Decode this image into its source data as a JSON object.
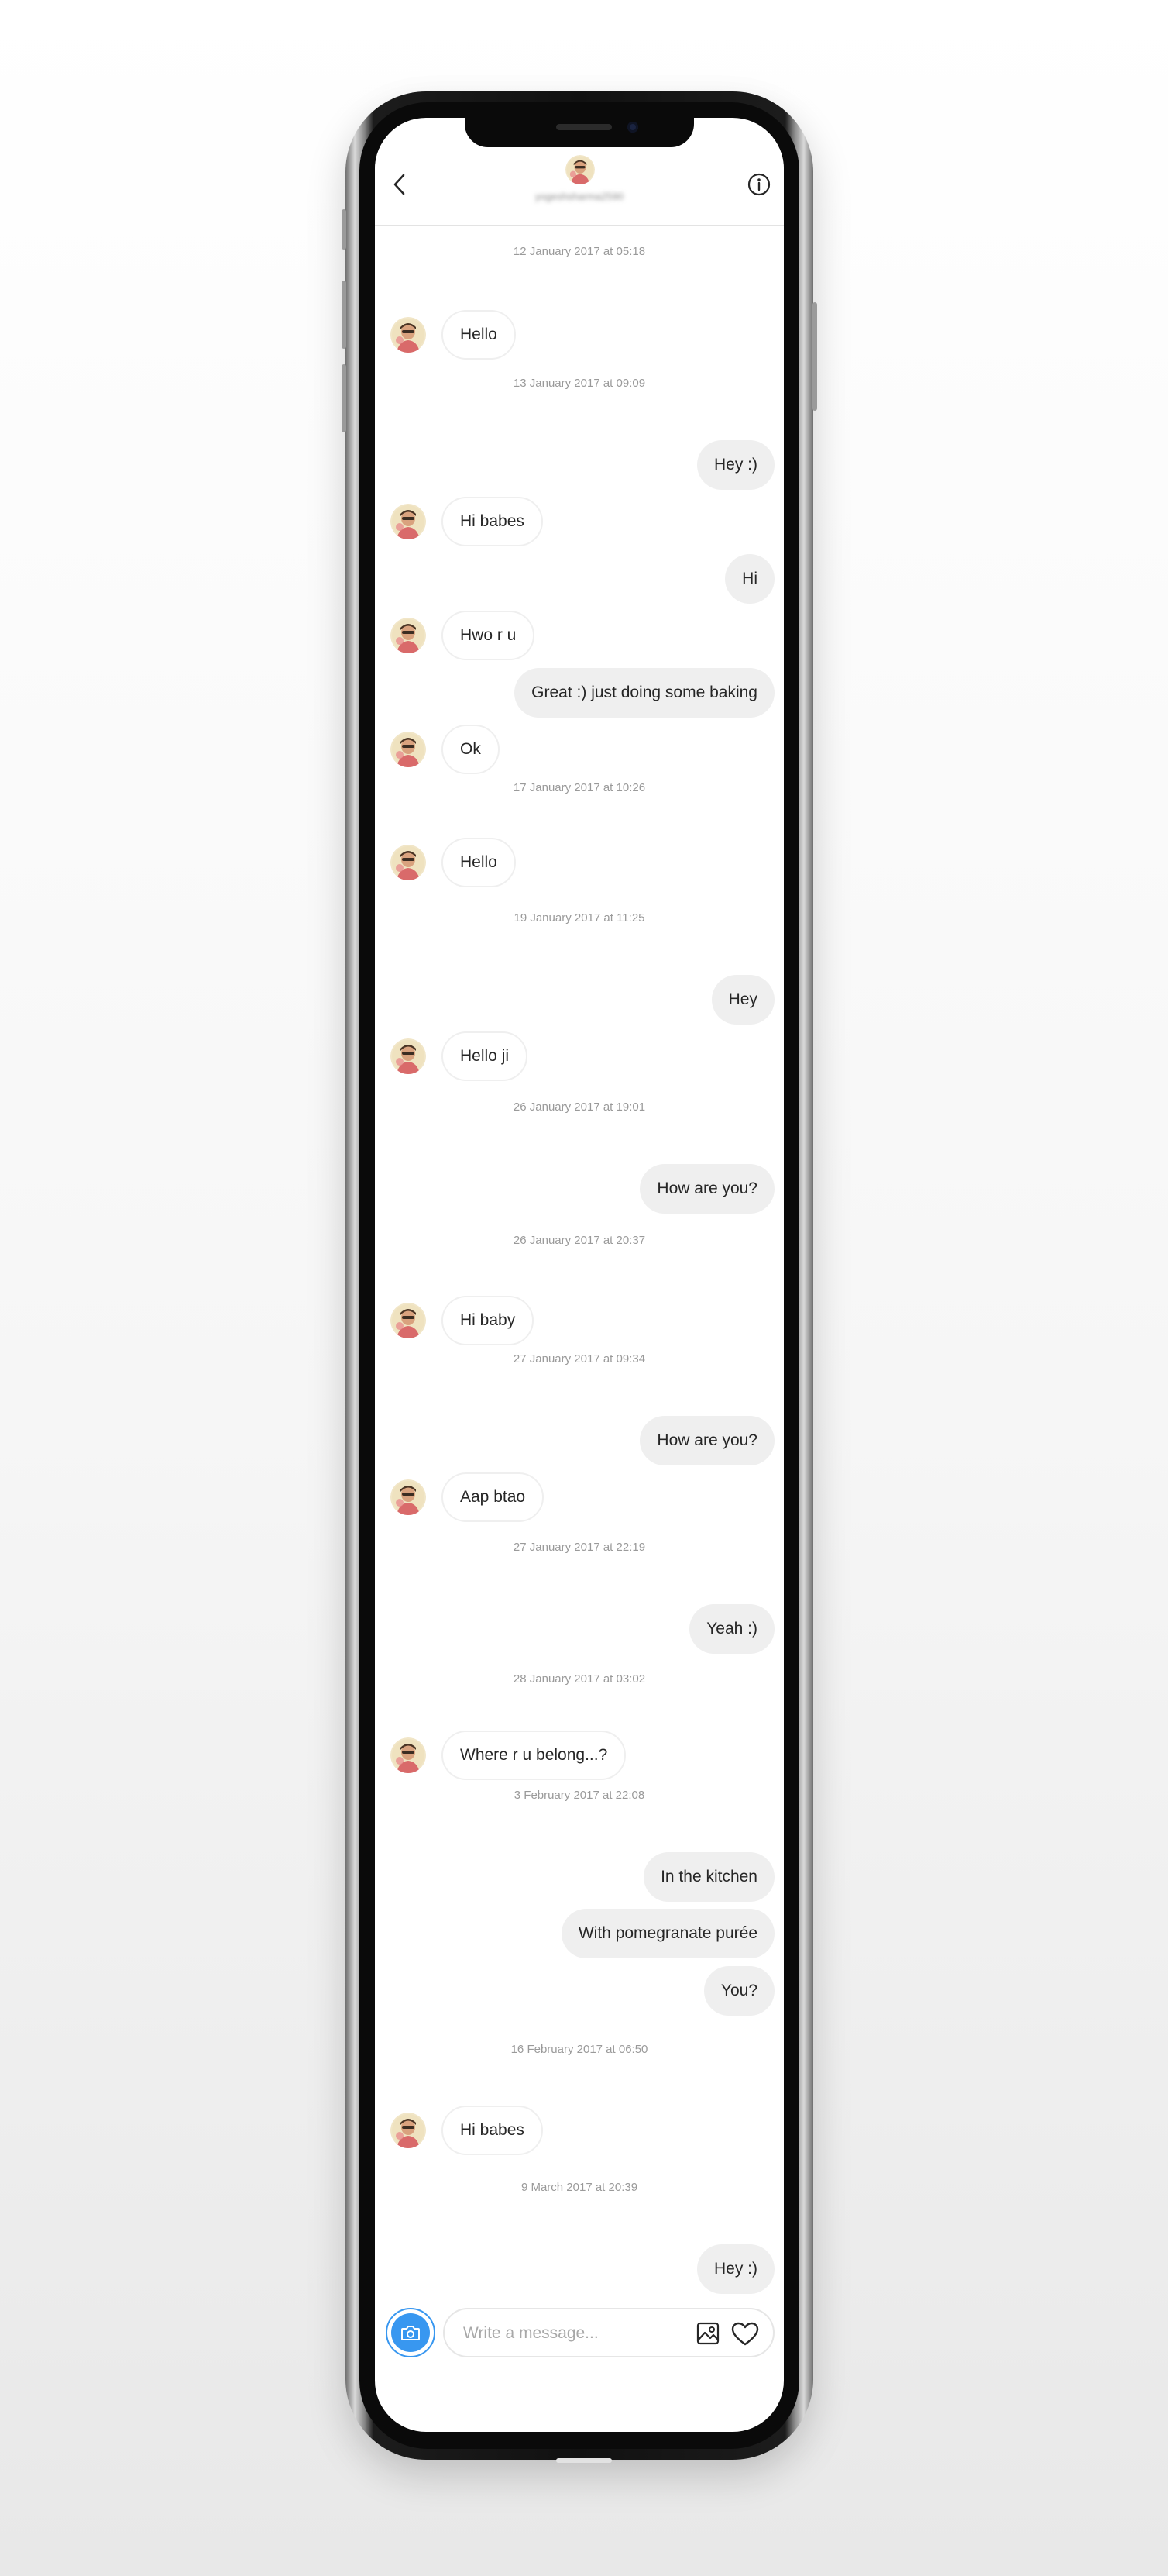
{
  "header": {
    "username": "yogeshsharma2590",
    "back_icon": "chevron-left-icon",
    "info_icon": "info-circle-icon"
  },
  "thread": [
    {
      "type": "timestamp",
      "text": "12 January 2017 at 05:18"
    },
    {
      "type": "in",
      "text": "Hello"
    },
    {
      "type": "timestamp",
      "text": "13 January 2017 at 09:09"
    },
    {
      "type": "out",
      "text": "Hey :)"
    },
    {
      "type": "in",
      "text": "Hi babes"
    },
    {
      "type": "out",
      "text": "Hi"
    },
    {
      "type": "in",
      "text": "Hwo r u"
    },
    {
      "type": "out",
      "text": "Great :) just doing some baking"
    },
    {
      "type": "in",
      "text": "Ok"
    },
    {
      "type": "timestamp",
      "text": "17 January 2017 at 10:26"
    },
    {
      "type": "in",
      "text": "Hello"
    },
    {
      "type": "timestamp",
      "text": "19 January 2017 at 11:25"
    },
    {
      "type": "out",
      "text": "Hey"
    },
    {
      "type": "in",
      "text": "Hello ji"
    },
    {
      "type": "timestamp",
      "text": "26 January 2017 at 19:01"
    },
    {
      "type": "out",
      "text": "How are you?"
    },
    {
      "type": "timestamp",
      "text": "26 January 2017 at 20:37"
    },
    {
      "type": "in",
      "text": "Hi baby"
    },
    {
      "type": "timestamp",
      "text": "27 January 2017 at 09:34"
    },
    {
      "type": "out",
      "text": "How are you?"
    },
    {
      "type": "in",
      "text": "Aap btao"
    },
    {
      "type": "timestamp",
      "text": "27 January 2017 at 22:19"
    },
    {
      "type": "out",
      "text": "Yeah :)"
    },
    {
      "type": "timestamp",
      "text": "28 January 2017 at 03:02"
    },
    {
      "type": "in",
      "text": "Where r u belong...?"
    },
    {
      "type": "timestamp",
      "text": "3 February 2017 at 22:08"
    },
    {
      "type": "out",
      "text": "In the kitchen"
    },
    {
      "type": "out",
      "text": "With pomegranate purée"
    },
    {
      "type": "out",
      "text": "You?"
    },
    {
      "type": "timestamp",
      "text": "16 February 2017 at 06:50"
    },
    {
      "type": "in",
      "text": "Hi babes"
    },
    {
      "type": "timestamp",
      "text": "9 March 2017 at 20:39"
    },
    {
      "type": "out",
      "text": "Hey :)"
    }
  ],
  "composer": {
    "placeholder": "Write a message...",
    "value": "",
    "camera_icon": "camera-icon",
    "gallery_icon": "image-icon",
    "like_icon": "heart-icon",
    "accent_color": "#3897f0"
  },
  "colors": {
    "outgoing_bubble": "#efefef",
    "incoming_border": "#efefef",
    "timestamp_text": "#9a9a9a"
  }
}
